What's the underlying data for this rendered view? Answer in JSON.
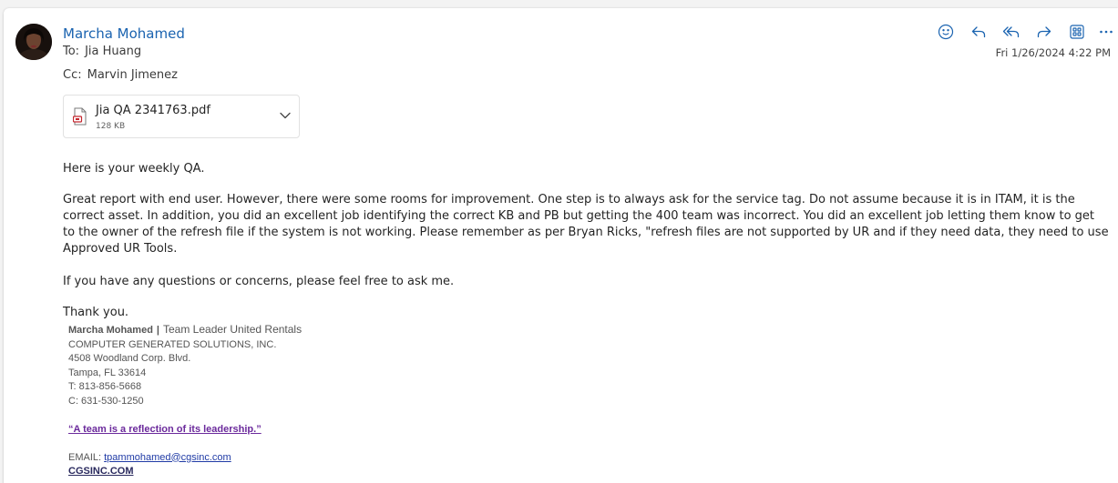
{
  "header": {
    "sender_name": "Marcha Mohamed",
    "to_label": "To:",
    "to_value": "Jia Huang",
    "cc_label": "Cc:",
    "cc_value": "Marvin Jimenez",
    "timestamp": "Fri 1/26/2024 4:22 PM",
    "actions": [
      "emoji-icon",
      "reply-icon",
      "reply-all-icon",
      "forward-icon",
      "apps-icon",
      "more-icon"
    ]
  },
  "attachment": {
    "filename": "Jia QA 2341763.pdf",
    "size": "128 KB",
    "icon": "pdf-file-icon"
  },
  "body": {
    "p1": "Here is your weekly QA.",
    "p2": "Great report with end user. However, there were some rooms for improvement. One step is to always ask for the service tag. Do not assume because it is in ITAM, it is the correct asset. In addition, you did an excellent job identifying the correct KB and PB but getting the 400 team was incorrect.  You did an excellent job letting them know to get to the owner of the refresh file if the system is not working. Please remember as per Bryan Ricks, \"refresh files are not supported by UR and if they need data, they need to use Approved UR Tools.",
    "p3": "If you have any questions or concerns, please feel free to ask me.",
    "p4": "Thank you."
  },
  "signature": {
    "name": "Marcha Mohamed",
    "separator": "|",
    "title": "Team Leader United Rentals",
    "company": "COMPUTER GENERATED SOLUTIONS, INC.",
    "address1": "4508 Woodland Corp. Blvd.",
    "address2": "Tampa, FL 33614",
    "phone_t": "T: 813-856-5668",
    "phone_c": "C: 631-530-1250",
    "quote": "“A team is a reflection of its leadership.”",
    "email_label": "EMAIL: ",
    "email": "tpammohamed@cgsinc.com",
    "website": "CGSINC.COM"
  },
  "colors": {
    "sender": "#1a63b0",
    "icon": "#1a63b0",
    "quote_link": "#6b2a9c",
    "email_link": "#1f3aa5"
  }
}
